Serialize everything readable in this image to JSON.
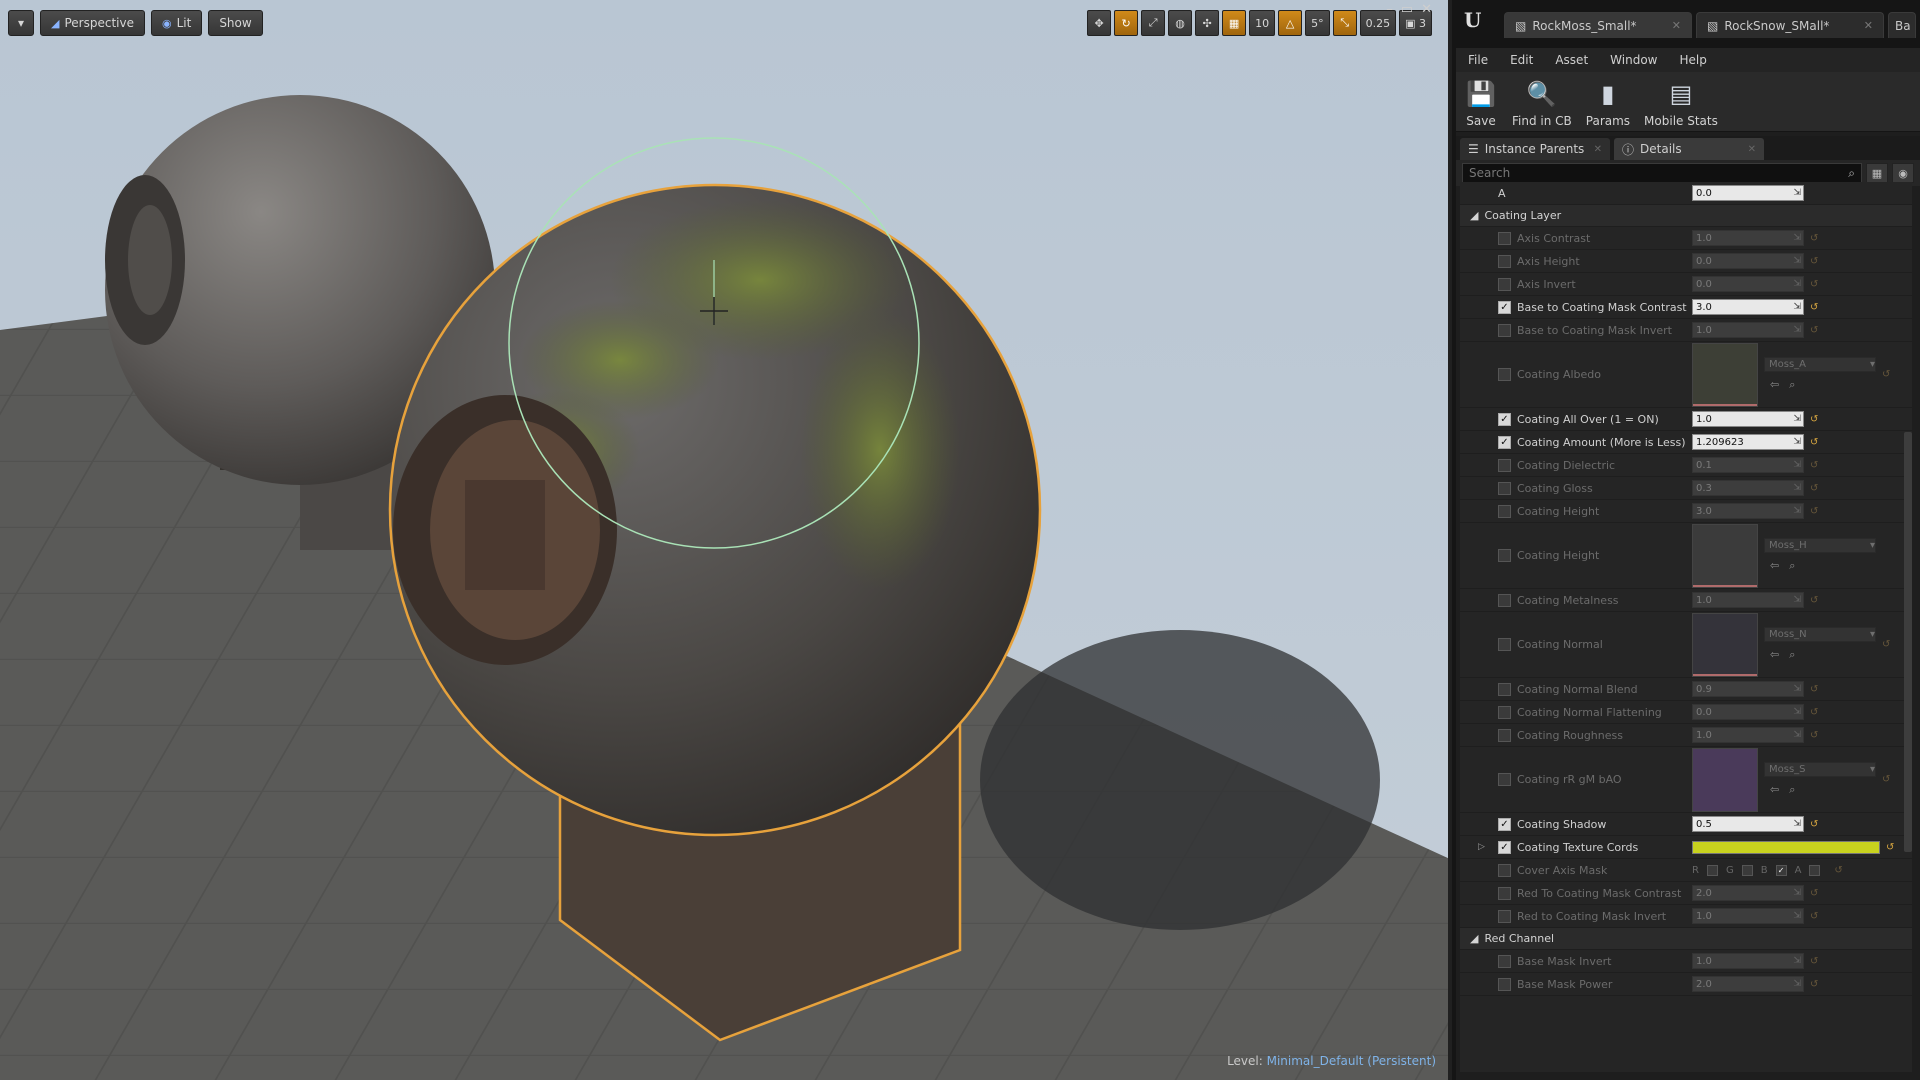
{
  "viewport": {
    "perspective_label": "Perspective",
    "lit_label": "Lit",
    "show_label": "Show",
    "grid_snap": "10",
    "rotation_snap": "5°",
    "scale_snap": "0.25",
    "camera_speed": "3",
    "level_label": "Level:",
    "level_name": "Minimal_Default (Persistent)"
  },
  "editor": {
    "logo": "U",
    "tabs": [
      {
        "label": "RockMoss_Small*"
      },
      {
        "label": "RockSnow_SMall*"
      },
      {
        "label": "Ba"
      }
    ],
    "menu": [
      "File",
      "Edit",
      "Asset",
      "Window",
      "Help"
    ],
    "toolbar": [
      {
        "label": "Save",
        "icon": "save-icon"
      },
      {
        "label": "Find in CB",
        "icon": "search-icon"
      },
      {
        "label": "Params",
        "icon": "params-icon"
      },
      {
        "label": "Mobile Stats",
        "icon": "mobile-stats-icon"
      }
    ],
    "panel_tabs": [
      {
        "label": "Instance Parents"
      },
      {
        "label": "Details"
      }
    ],
    "search_placeholder": "Search"
  },
  "properties": {
    "top_row": {
      "name": "A",
      "value": "0.0"
    },
    "coating_category": "Coating Layer",
    "axis_contrast": {
      "name": "Axis Contrast",
      "value": "1.0"
    },
    "axis_height": {
      "name": "Axis Height",
      "value": "0.0"
    },
    "axis_invert": {
      "name": "Axis Invert",
      "value": "0.0"
    },
    "base_mask_contrast": {
      "name": "Base to Coating Mask Contrast",
      "value": "3.0"
    },
    "base_mask_invert": {
      "name": "Base to Coating Mask Invert",
      "value": "1.0"
    },
    "coating_albedo": {
      "name": "Coating Albedo",
      "texture": "Moss_A"
    },
    "coating_all_over": {
      "name": "Coating All Over (1 = ON)",
      "value": "1.0"
    },
    "coating_amount": {
      "name": "Coating Amount (More is Less)",
      "value": "1.209623"
    },
    "coating_dielectric": {
      "name": "Coating Dielectric",
      "value": "0.1"
    },
    "coating_gloss": {
      "name": "Coating Gloss",
      "value": "0.3"
    },
    "coating_height_scalar": {
      "name": "Coating Height",
      "value": "3.0"
    },
    "coating_height_tex": {
      "name": "Coating Height",
      "texture": "Moss_H"
    },
    "coating_metalness": {
      "name": "Coating Metalness",
      "value": "1.0"
    },
    "coating_normal": {
      "name": "Coating Normal",
      "texture": "Moss_N"
    },
    "coating_normal_blend": {
      "name": "Coating Normal Blend",
      "value": "0.9"
    },
    "coating_normal_flat": {
      "name": "Coating Normal Flattening",
      "value": "0.0"
    },
    "coating_roughness": {
      "name": "Coating Roughness",
      "value": "1.0"
    },
    "coating_rgb": {
      "name": "Coating rR gM bAO",
      "texture": "Moss_S"
    },
    "coating_shadow": {
      "name": "Coating Shadow",
      "value": "0.5"
    },
    "coating_tex_cords": {
      "name": "Coating Texture Cords",
      "color": "#c8d21e"
    },
    "cover_axis_mask": {
      "name": "Cover Axis Mask",
      "channels": [
        "R",
        "G",
        "B",
        "A"
      ]
    },
    "red_mask_contrast": {
      "name": "Red To Coating Mask Contrast",
      "value": "2.0"
    },
    "red_mask_invert": {
      "name": "Red to Coating Mask Invert",
      "value": "1.0"
    },
    "red_category": "Red Channel",
    "base_mask_invert2": {
      "name": "Base Mask Invert",
      "value": "1.0"
    },
    "base_mask_power": {
      "name": "Base Mask Power",
      "value": "2.0"
    }
  },
  "colors": {
    "accent_orange": "#d08a1a",
    "selection_outline": "#e7a23c",
    "tex_cords_yellow": "#c8d21e"
  }
}
